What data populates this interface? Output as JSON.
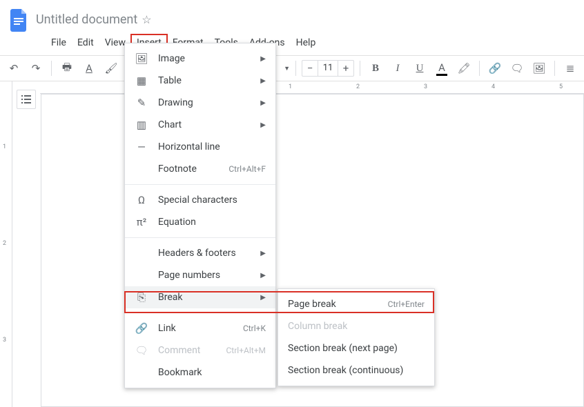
{
  "doc": {
    "title": "Untitled document"
  },
  "menubar": [
    "File",
    "Edit",
    "View",
    "Insert",
    "Format",
    "Tools",
    "Add-ons",
    "Help"
  ],
  "open_menu_index": 3,
  "toolbar": {
    "font_size": "11"
  },
  "hruler": [
    "1",
    "2",
    "3",
    "4",
    "5"
  ],
  "vruler": [
    "1",
    "2",
    "3"
  ],
  "insert_menu": {
    "items": [
      {
        "icon": "🖼",
        "label": "Image",
        "sub": true
      },
      {
        "icon": "▦",
        "label": "Table",
        "sub": true
      },
      {
        "icon": "✎",
        "label": "Drawing",
        "sub": true
      },
      {
        "icon": "▥",
        "label": "Chart",
        "sub": true
      },
      {
        "icon": "—",
        "label": "Horizontal line"
      },
      {
        "icon": "",
        "label": "Footnote",
        "shortcut": "Ctrl+Alt+F"
      },
      {
        "sep": true
      },
      {
        "icon": "Ω",
        "label": "Special characters"
      },
      {
        "icon": "π²",
        "label": "Equation"
      },
      {
        "sep": true
      },
      {
        "icon": "",
        "label": "Headers & footers",
        "sub": true
      },
      {
        "icon": "",
        "label": "Page numbers",
        "sub": true
      },
      {
        "icon": "⎘",
        "label": "Break",
        "sub": true,
        "open": true
      },
      {
        "sep": true
      },
      {
        "icon": "🔗",
        "label": "Link",
        "shortcut": "Ctrl+K"
      },
      {
        "icon": "🗨",
        "label": "Comment",
        "shortcut": "Ctrl+Alt+M",
        "disabled": true
      },
      {
        "icon": "",
        "label": "Bookmark"
      }
    ]
  },
  "break_menu": {
    "items": [
      {
        "label": "Page break",
        "shortcut": "Ctrl+Enter"
      },
      {
        "label": "Column break",
        "disabled": true
      },
      {
        "label": "Section break (next page)"
      },
      {
        "label": "Section break (continuous)"
      }
    ]
  }
}
